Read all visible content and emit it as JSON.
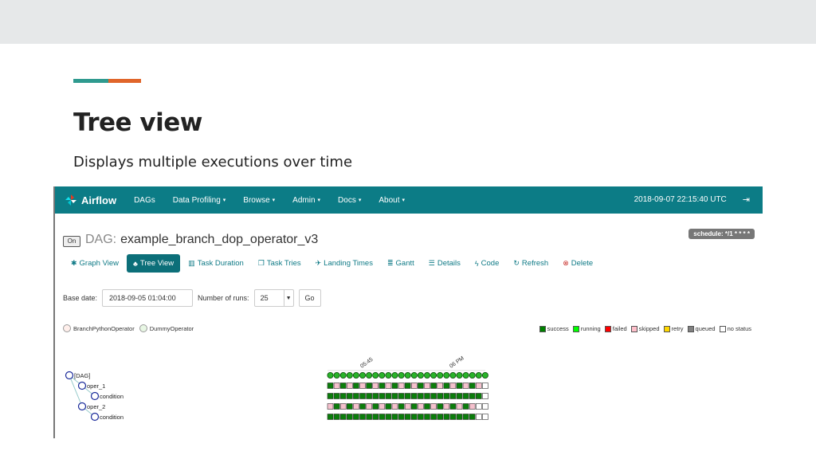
{
  "slide": {
    "title": "Tree view",
    "subtitle": "Displays multiple executions over time"
  },
  "navbar": {
    "brand": "Airflow",
    "items": [
      {
        "label": "DAGs",
        "dropdown": false
      },
      {
        "label": "Data Profiling",
        "dropdown": true
      },
      {
        "label": "Browse",
        "dropdown": true
      },
      {
        "label": "Admin",
        "dropdown": true
      },
      {
        "label": "Docs",
        "dropdown": true
      },
      {
        "label": "About",
        "dropdown": true
      }
    ],
    "timestamp": "2018-09-07 22:15:40 UTC",
    "logout_icon": "sign-out-icon"
  },
  "dag": {
    "on_label": "On",
    "prefix": "DAG:",
    "name": "example_branch_dop_operator_v3",
    "schedule": "schedule: */1 * * * *"
  },
  "tabs": [
    {
      "label": "Graph View",
      "icon": "asterisk-icon",
      "active": false
    },
    {
      "label": "Tree View",
      "icon": "tree-icon",
      "active": true
    },
    {
      "label": "Task Duration",
      "icon": "stats-icon",
      "active": false
    },
    {
      "label": "Task Tries",
      "icon": "duplicate-icon",
      "active": false
    },
    {
      "label": "Landing Times",
      "icon": "plane-icon",
      "active": false
    },
    {
      "label": "Gantt",
      "icon": "align-left-icon",
      "active": false
    },
    {
      "label": "Details",
      "icon": "list-icon",
      "active": false
    },
    {
      "label": "Code",
      "icon": "flash-icon",
      "active": false
    },
    {
      "label": "Refresh",
      "icon": "refresh-icon",
      "active": false
    },
    {
      "label": "Delete",
      "icon": "remove-circle-icon",
      "active": false
    }
  ],
  "form": {
    "base_date_label": "Base date:",
    "base_date_value": "2018-09-05 01:04:00",
    "runs_label": "Number of runs:",
    "runs_value": "25",
    "go_label": "Go"
  },
  "operators": [
    {
      "label": "BranchPythonOperator",
      "color": "#ffefeb"
    },
    {
      "label": "DummyOperator",
      "color": "#e8f7e4"
    }
  ],
  "status_legend": [
    {
      "label": "success",
      "color": "#008000"
    },
    {
      "label": "running",
      "color": "#00ff00"
    },
    {
      "label": "failed",
      "color": "#ff0000"
    },
    {
      "label": "skipped",
      "color": "#ffc0cb"
    },
    {
      "label": "retry",
      "color": "#ffd700"
    },
    {
      "label": "queued",
      "color": "#808080"
    },
    {
      "label": "no status",
      "color": "#ffffff"
    }
  ],
  "tree": {
    "time_labels": [
      "05:45",
      "06 PM"
    ],
    "nodes": [
      {
        "label": "[DAG]",
        "depth": 0
      },
      {
        "label": "oper_1",
        "depth": 1
      },
      {
        "label": "condition",
        "depth": 2
      },
      {
        "label": "oper_2",
        "depth": 1
      },
      {
        "label": "condition",
        "depth": 2
      }
    ],
    "rows": [
      "RRRRRRRRRRRRRRRRRRRRRRRRR",
      "SKSKSKSKSKSKSKSKSKSKSKSKN",
      "SSSSSSSSSSSSSSSSSSSSSSSSN",
      "KSKSKSKSKSKSKSKSKSKSKSKNN",
      "SSSSSSSSSSSSSSSSSSSSSSSNN"
    ]
  }
}
